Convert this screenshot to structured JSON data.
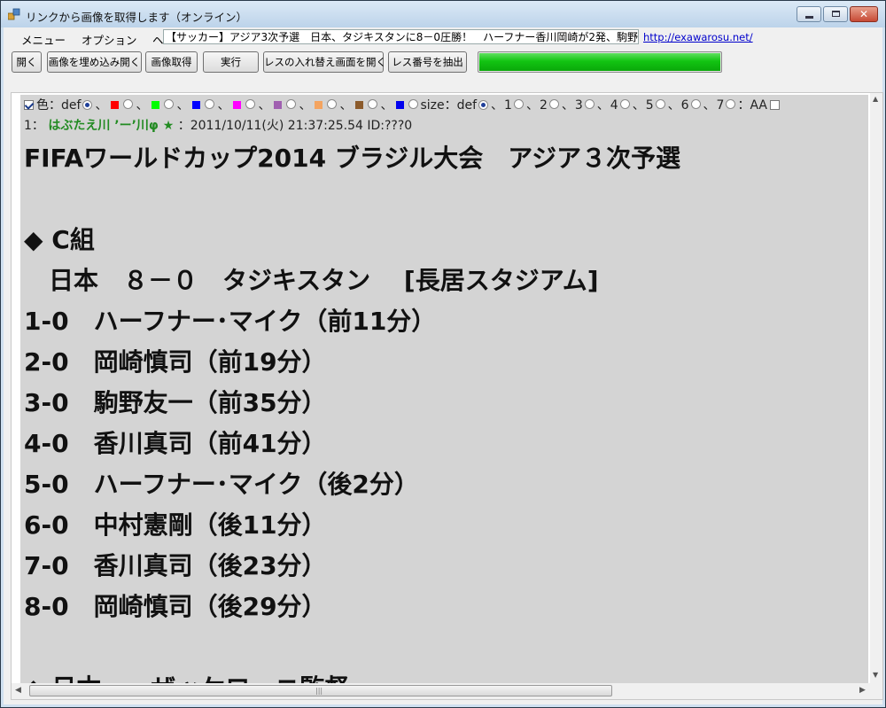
{
  "window": {
    "title": "リンクから画像を取得します（オンライン）",
    "controls": {
      "minimize": "minimize",
      "maximize": "maximize",
      "close": "✕"
    }
  },
  "menu": {
    "items": [
      "メニュー",
      "オプション",
      "ヘ"
    ],
    "thread_title": "【サッカー】アジア3次予選　日本、タジキスタンに8－0圧勝！　ハーフナー香川岡崎が2発、駒野憲剛も決めグル",
    "url": "http://exawarosu.net/"
  },
  "toolbar": {
    "buttons": [
      "開く",
      "画像を埋め込み開く",
      "画像取得",
      "実行",
      "レスの入れ替え画面を開く",
      "レス番号を抽出"
    ],
    "progress_fraction": 1.0
  },
  "options": {
    "color_label": "色：def",
    "color_swatches": [
      "#ff0000",
      "#00ff00",
      "#0000ff",
      "#ff00ff",
      "#a060b0",
      "#f4a460",
      "#8b5a2b",
      "#0000ee"
    ],
    "size_label": "size：def",
    "sizes": [
      "1",
      "2",
      "3",
      "4",
      "5",
      "6",
      "7"
    ],
    "aa_label": "：AA",
    "sep": "、"
  },
  "post": {
    "number": "1：",
    "name": "はぶたえ川 ’ー’川φ ★",
    "meta": "：2011/10/11(火) 21:37:25.54 ID:???0",
    "lines": [
      "FIFAワールドカップ2014 ブラジル大会　アジア３次予選",
      "",
      "◆ C組",
      "　日本　８－０　タジキスタン　 [長居スタジアム]",
      "1-0　ハーフナー･マイク（前11分）",
      "2-0　岡崎慎司（前19分）",
      "3-0　駒野友一（前35分）",
      "4-0　香川真司（前41分）",
      "5-0　ハーフナー･マイク（後2分）",
      "6-0　中村憲剛（後11分）",
      "7-0　香川真司（後23分）",
      "8-0　岡崎慎司（後29分）",
      "",
      "◆ 日本　　ザッケローニ監督"
    ]
  },
  "scrollbars": {
    "up": "▲",
    "down": "▼",
    "left": "◀",
    "right": "▶",
    "grip": "|||"
  },
  "colors": {
    "progress": "#12c412",
    "poster_name": "#228b22",
    "link": "#0000cc",
    "content_bg": "#d4d4d4"
  }
}
